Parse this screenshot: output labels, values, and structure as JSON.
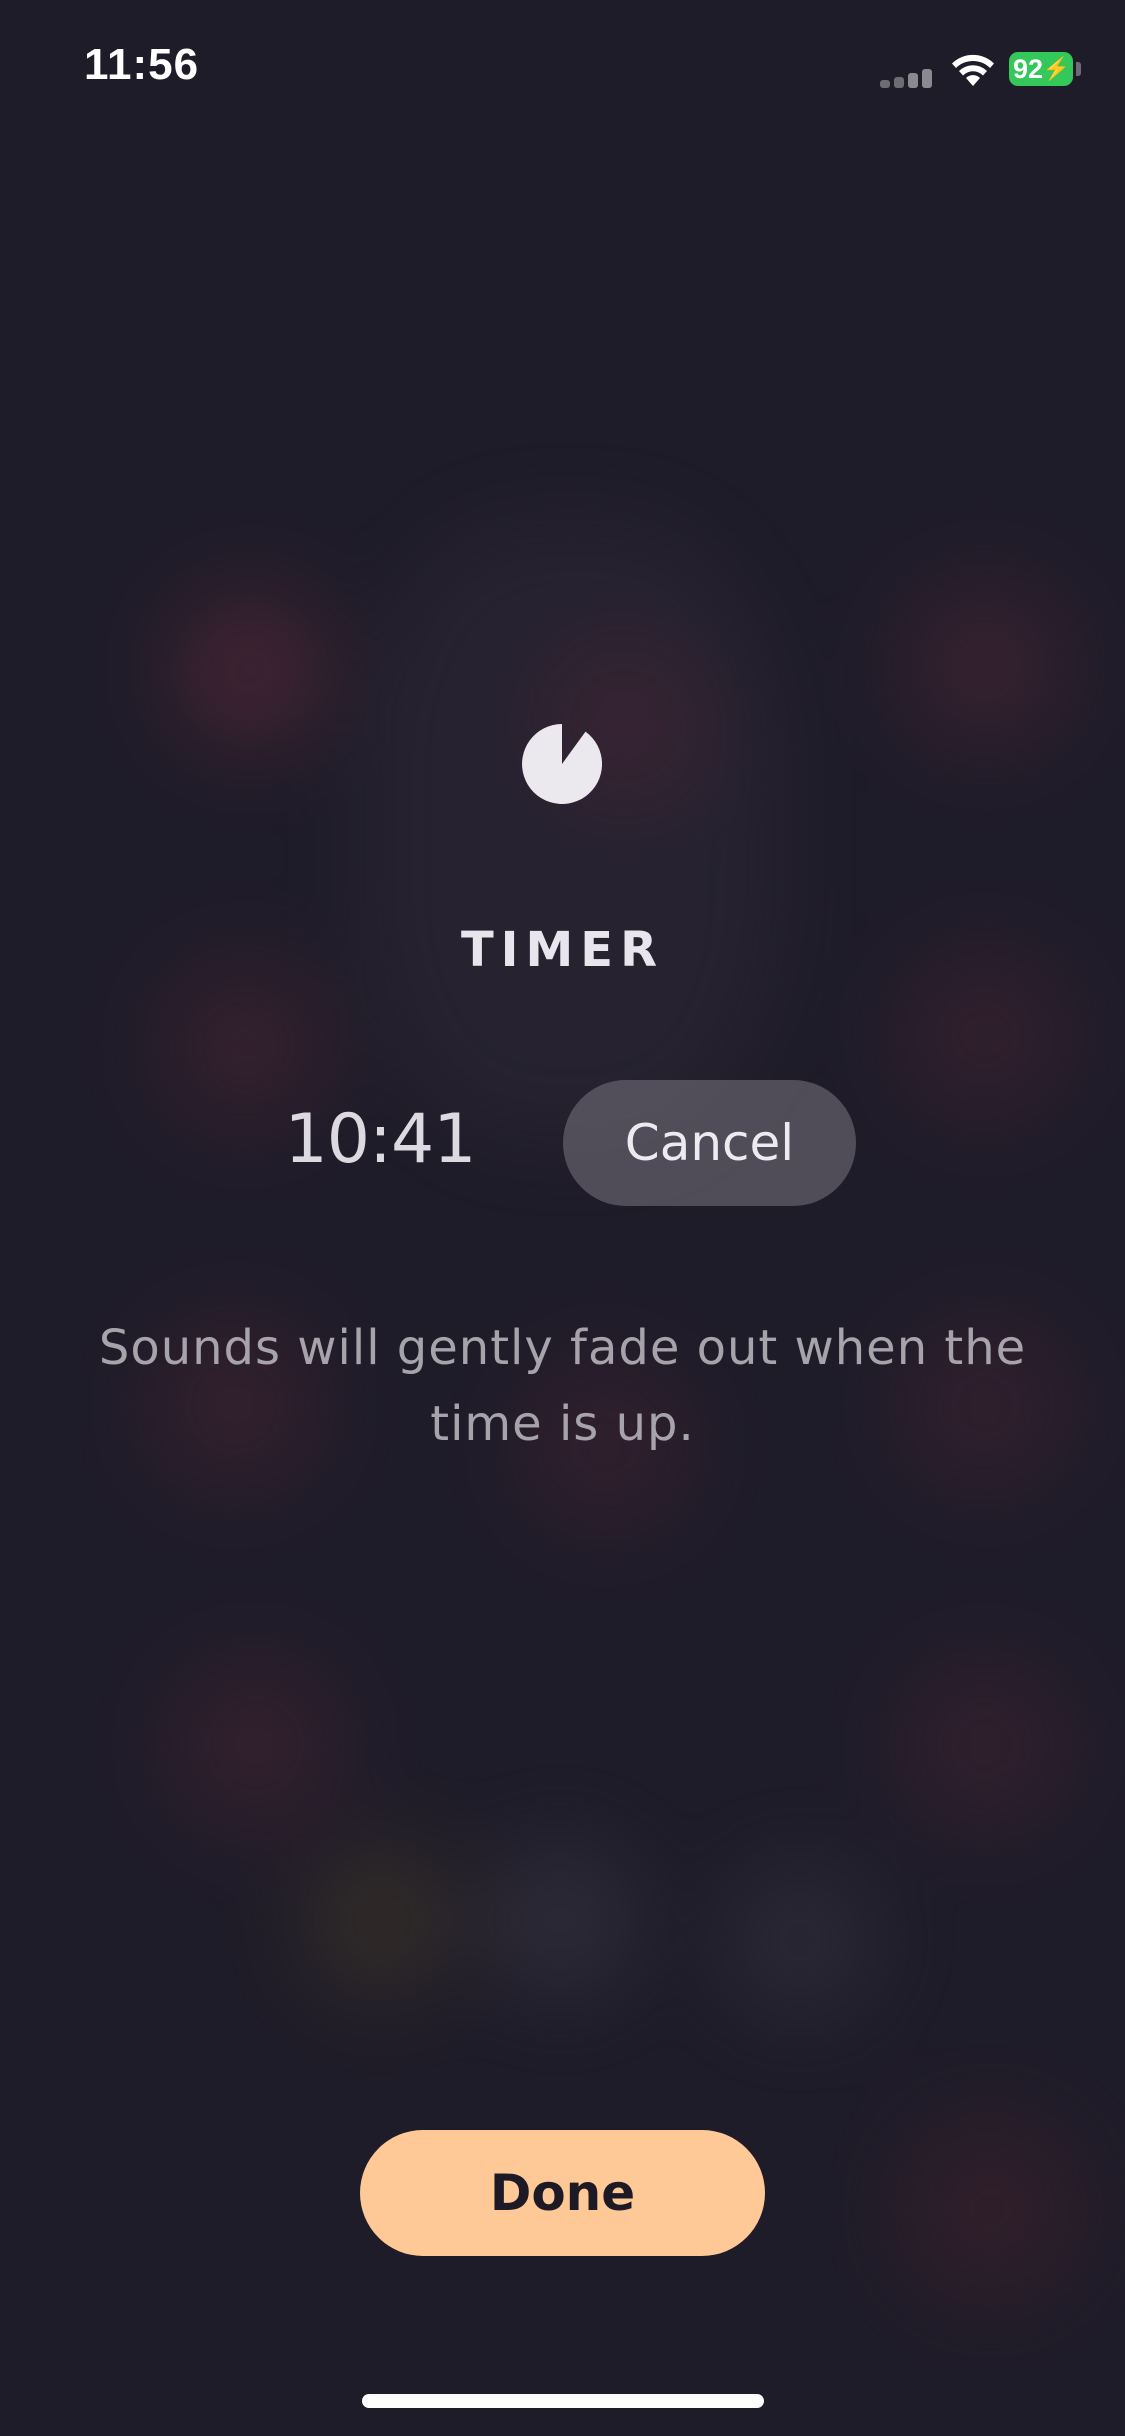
{
  "status_bar": {
    "time": "11:56",
    "battery_level": "92",
    "battery_charging": true,
    "battery_color": "#34c759",
    "signal_icon": "cellular-signal-icon",
    "wifi_icon": "wifi-icon"
  },
  "timer": {
    "icon": "timer-pie-icon",
    "title": "TIMER",
    "remaining": "10:41",
    "cancel_label": "Cancel",
    "message": "Sounds will gently fade out when the time is up."
  },
  "footer": {
    "done_label": "Done",
    "done_color": "#ffc897"
  },
  "colors": {
    "background": "#1f1c29",
    "accent": "#ffc897"
  }
}
